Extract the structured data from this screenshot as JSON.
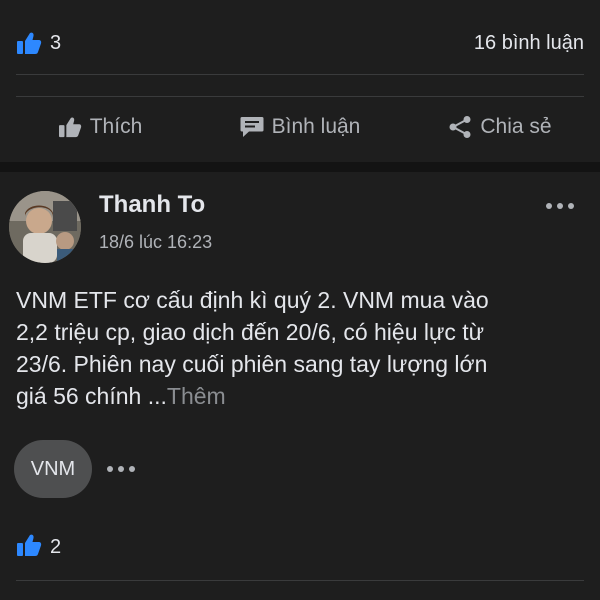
{
  "top_reactions": {
    "like_count": "3",
    "comment_count_label": "16 bình luận"
  },
  "actions": {
    "like": "Thích",
    "comment": "Bình luận",
    "share": "Chia sẻ"
  },
  "post": {
    "author": "Thanh To",
    "timestamp": "18/6 lúc 16:23",
    "line1": "VNM ETF cơ cấu định kì quý 2. VNM mua vào",
    "line2": "2,2 triệu cp, giao dịch đến 20/6, có hiệu lực từ",
    "line3": "23/6. Phiên nay cuối phiên sang tay lượng lớn",
    "line4": "giá 56 chính ...",
    "see_more": "Thêm",
    "tag": "VNM",
    "like_count": "2"
  },
  "colors": {
    "background": "#1e1e1e",
    "like_blue": "#2d88ff",
    "muted_text": "#b0b3b8"
  },
  "icons": [
    "like-icon",
    "comment-icon",
    "share-icon",
    "more-icon"
  ]
}
